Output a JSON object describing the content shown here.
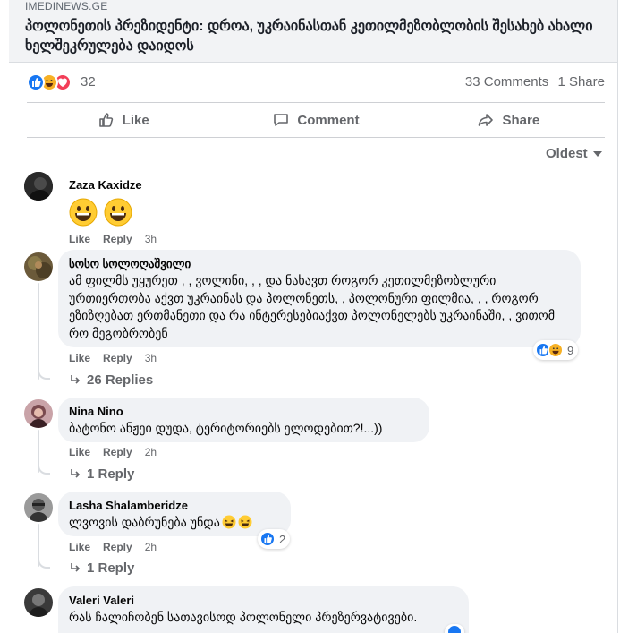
{
  "post": {
    "domain": "IMEDINEWS.GE",
    "headline": "პოლონეთის პრეზიდენტი: დროა, უკრაინასთან კეთილმეზობლობის შესახებ ახალი ხელშეკრულება დაიდოს"
  },
  "stats": {
    "reaction_icons": [
      "like-icon",
      "haha-icon",
      "love-icon"
    ],
    "reaction_count": "32",
    "comments": "33 Comments",
    "shares": "1 Share"
  },
  "actions": {
    "like": "Like",
    "comment": "Comment",
    "share": "Share"
  },
  "sort": {
    "label": "Oldest"
  },
  "comments": [
    {
      "author": "Zaza Kaxidze",
      "text": "",
      "emojis": [
        "grinning-face-emoji",
        "grinning-face-emoji"
      ],
      "like": "Like",
      "reply": "Reply",
      "time": "3h"
    },
    {
      "author": "სოსო სოლოღაშვილი",
      "text": "ამ ფილმს უყურეთ , , ვოლინი, , , და ნახავთ როგორ კეთილმეზობლური ურთიერთობა აქვთ უკრაინას და პოლონეთს, , პოლონური ფილმია, , , როგორ ეზიზღებათ ერთმანეთი და რა ინტერესებიაქვთ პოლონელებს უკრაინაში, , ვითომ რო მეგობრობენ",
      "like": "Like",
      "reply": "Reply",
      "time": "3h",
      "reaction_icons": [
        "like-icon",
        "haha-icon"
      ],
      "reaction_count": "9",
      "replies": "26 Replies"
    },
    {
      "author": "Nina Nino",
      "text": "ბატონო ანჟეი დუდა, ტერიტორიებს ელოდებით?!...))",
      "like": "Like",
      "reply": "Reply",
      "time": "2h",
      "replies": "1 Reply"
    },
    {
      "author": "Lasha Shalamberidze",
      "text": "ლვოვის დაბრუნება უნდა",
      "emojis": [
        "laughing-face-emoji",
        "laughing-face-emoji"
      ],
      "like": "Like",
      "reply": "Reply",
      "time": "2h",
      "reaction_icons": [
        "like-icon"
      ],
      "reaction_count": "2",
      "replies": "1 Reply"
    },
    {
      "author": "Valeri Valeri",
      "text": "რას ჩალიჩობენ სათავისოდ პოლონელი პრეზერვატივები.",
      "reaction_icons": [
        "like-icon"
      ]
    }
  ],
  "colors": {
    "accent": "#1877f2",
    "haha": "#f7b125",
    "love": "#f33e58",
    "bubble": "#f0f2f5",
    "muted": "#65676b"
  }
}
